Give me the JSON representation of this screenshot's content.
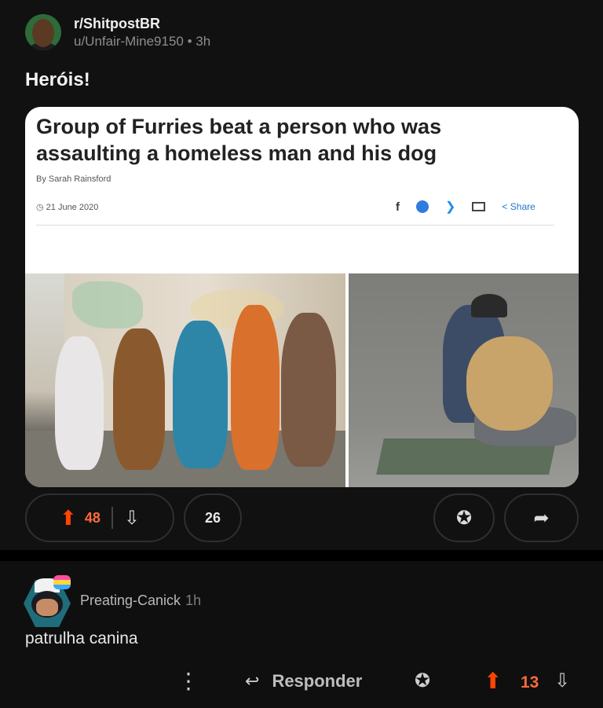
{
  "post": {
    "subreddit": "r/ShitpostBR",
    "author": "u/Unfair-Mine9150",
    "age": "3h",
    "title": "Heróis!",
    "image": {
      "headline": "Group of Furries beat a person who was assaulting a homeless man and his dog",
      "byline": "By Sarah Rainsford",
      "date": "21 June 2020",
      "share_label": "Share",
      "share_icons": [
        "facebook-icon",
        "messenger-icon",
        "twitter-icon",
        "email-icon",
        "share-arrow-icon"
      ]
    },
    "upvotes": "48",
    "comments": "26",
    "colors": {
      "upvote": "#ff4500",
      "background": "#111112"
    }
  },
  "comment": {
    "username": "Preating-Canick",
    "age": "1h",
    "body": "patrulha canina",
    "reply_label": "Responder",
    "upvotes": "13"
  }
}
